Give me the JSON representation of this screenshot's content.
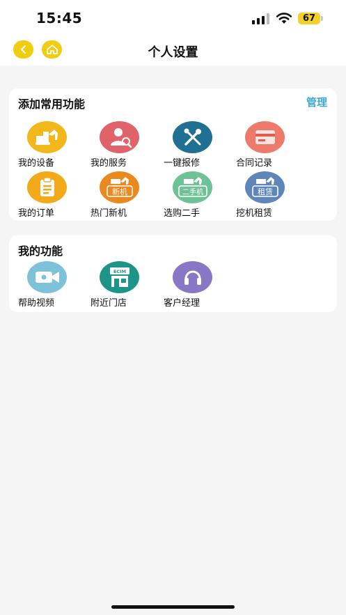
{
  "status_bar": {
    "time": "15:45",
    "battery": "67"
  },
  "nav": {
    "title": "个人设置"
  },
  "common_section": {
    "title": "添加常用功能",
    "action": "管理",
    "items": [
      {
        "label": "我的设备",
        "icon": "excavator-icon",
        "color": "#f2b81b"
      },
      {
        "label": "我的服务",
        "icon": "service-person-icon",
        "color": "#e0626a"
      },
      {
        "label": "一键报修",
        "icon": "wrench-screwdriver-icon",
        "color": "#1f7092"
      },
      {
        "label": "合同记录",
        "icon": "credit-card-icon",
        "color": "#ee7a6c"
      },
      {
        "label": "我的订单",
        "icon": "clipboard-icon",
        "color": "#f2aa1b"
      },
      {
        "label": "热门新机",
        "icon": "new-machine-icon",
        "color": "#ea8a1e",
        "badge": "新机"
      },
      {
        "label": "选购二手",
        "icon": "used-machine-icon",
        "color": "#6fc298",
        "badge": "二手机"
      },
      {
        "label": "挖机租赁",
        "icon": "rental-machine-icon",
        "color": "#5f86b8",
        "badge": "租赁"
      }
    ]
  },
  "mine_section": {
    "title": "我的功能",
    "items": [
      {
        "label": "帮助视频",
        "icon": "video-camera-icon",
        "color": "#7ec2d9"
      },
      {
        "label": "附近门店",
        "icon": "store-icon",
        "color": "#1d9488",
        "badge": "ECIM"
      },
      {
        "label": "客户经理",
        "icon": "headset-icon",
        "color": "#8877c4"
      }
    ]
  }
}
